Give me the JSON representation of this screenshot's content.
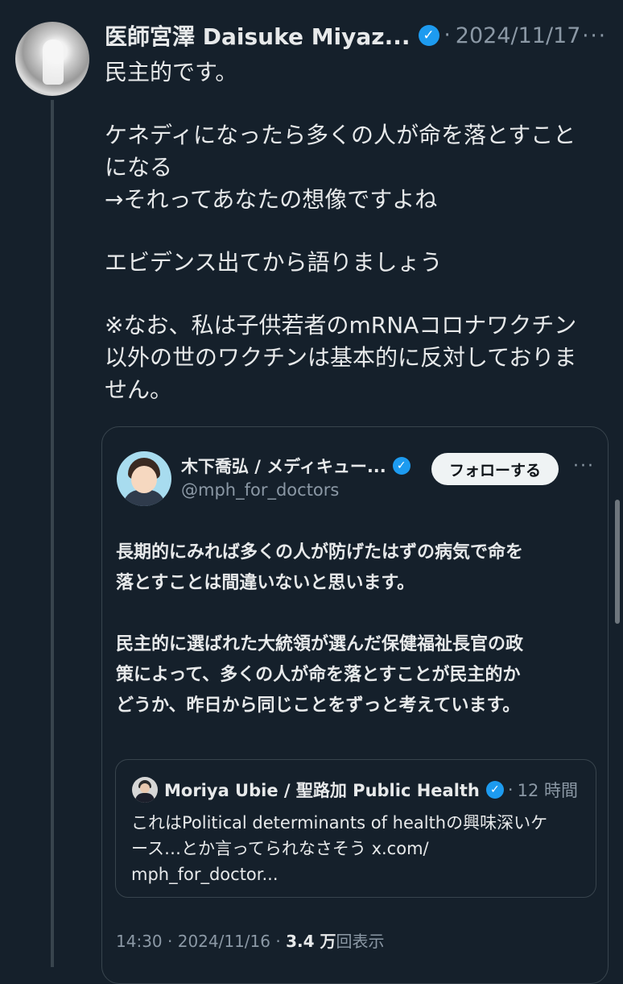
{
  "main_tweet": {
    "author_name": "医師宮澤 Daisuke Miyaz...",
    "separator": "·",
    "date": "2024/11/17",
    "more": "···",
    "text_lines": [
      "民主的です。",
      "",
      "ケネディになったら多くの人が命を落とすこと",
      "になる",
      "→それってあなたの想像ですよね",
      "",
      "エビデンス出てから語りましょう",
      "",
      "※なお、私は子供若者のmRNAコロナワクチン",
      "以外の世のワクチンは基本的に反対しておりま",
      "せん。"
    ]
  },
  "quoted_tweet": {
    "author_name": "木下喬弘 / メディキュー...",
    "handle": "@mph_for_doctors",
    "follow_label": "フォローする",
    "more": "···",
    "text_lines": [
      "長期的にみれば多くの人が防げたはずの病気で命を",
      "落とすことは間違いないと思います。",
      "",
      "民主的に選ばれた大統領が選んだ保健福祉長官の政",
      "策によって、多くの人が命を落とすことが民主的か",
      "どうか、昨日から同じことをずっと考えています。"
    ],
    "time": "14:30",
    "date": "2024/11/16",
    "views_count": "3.4 万",
    "views_label": "回表示",
    "meta_separator": "·"
  },
  "nested_tweet": {
    "author_name": "Moriya Ubie / 聖路加 Public Health",
    "separator": "·",
    "time_ago": "12 時間",
    "text_lines": [
      "これはPolitical determinants of healthの興味深いケ",
      "ース…とか言ってられなさそう x.com/",
      "mph_for_doctor..."
    ]
  },
  "icons": {
    "verified": "verified-badge-icon",
    "more": "more-horizontal-icon"
  },
  "colors": {
    "background": "#15202b",
    "text": "#e7e9ea",
    "muted": "#8b98a5",
    "accent": "#1d9bf0",
    "border": "#38444d"
  }
}
